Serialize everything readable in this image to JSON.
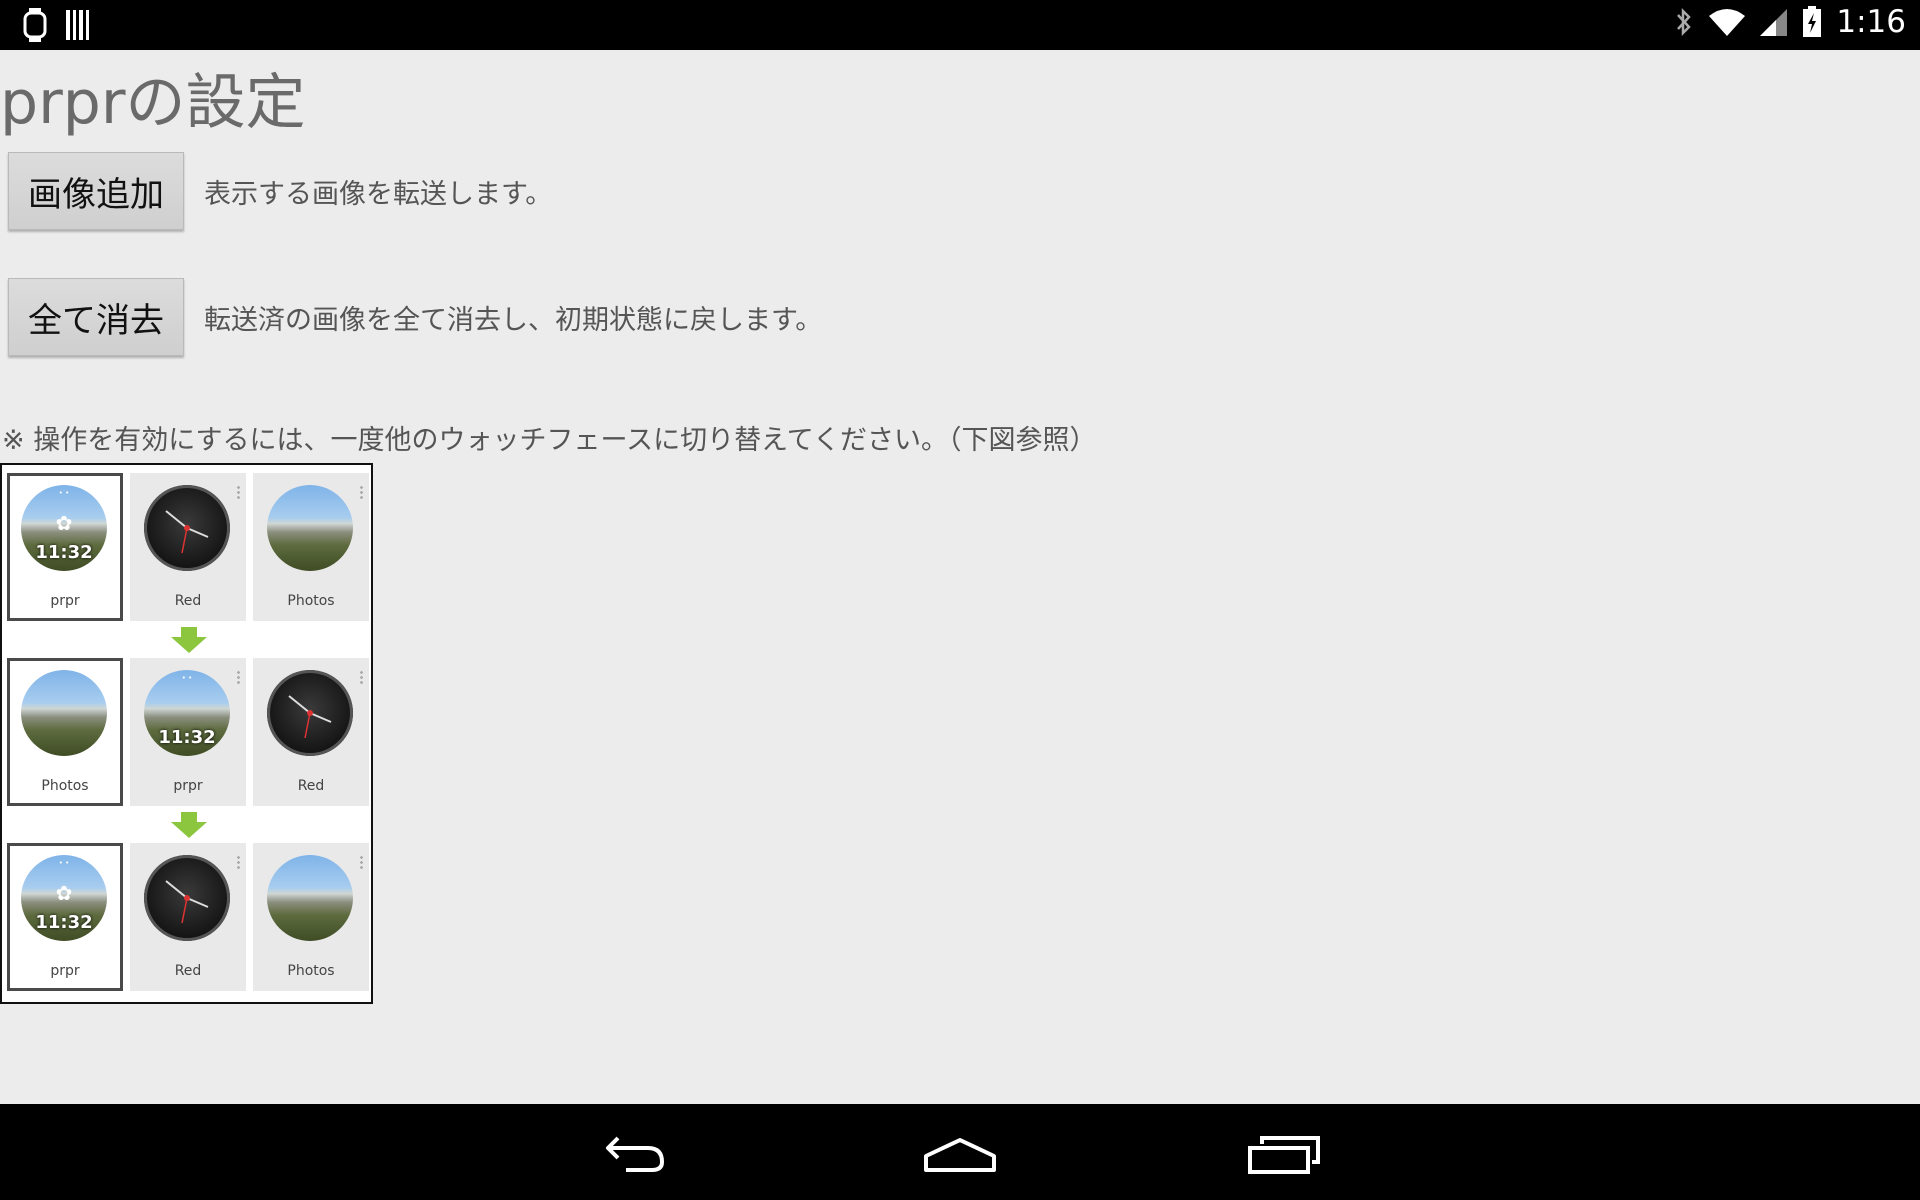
{
  "status_bar": {
    "time": "1:16",
    "left_icons": [
      "watch-icon",
      "barcode-icon"
    ],
    "right_icons": [
      "bluetooth-icon",
      "wifi-icon",
      "signal-icon",
      "battery-charging-icon"
    ]
  },
  "page": {
    "title": "prprの設定",
    "add_image": {
      "label": "画像追加",
      "description": "表示する画像を転送します。"
    },
    "clear_all": {
      "label": "全て消去",
      "description": "転送済の画像を全て消去し、初期状態に戻します。"
    },
    "note": "※ 操作を有効にするには、一度他のウォッチフェースに切り替えてください。（下図参照）"
  },
  "illustration": {
    "rows": [
      {
        "cards": [
          {
            "label": "prpr",
            "face": "photo",
            "time": "11:32",
            "gear": true,
            "selected": true
          },
          {
            "label": "Red",
            "face": "dark",
            "selected": false
          },
          {
            "label": "Photos",
            "face": "photo",
            "selected": false
          }
        ]
      },
      {
        "cards": [
          {
            "label": "Photos",
            "face": "photo",
            "selected": true
          },
          {
            "label": "prpr",
            "face": "photo",
            "time": "11:32",
            "selected": false
          },
          {
            "label": "Red",
            "face": "dark",
            "selected": false
          }
        ]
      },
      {
        "cards": [
          {
            "label": "prpr",
            "face": "photo",
            "time": "11:32",
            "gear": true,
            "selected": true
          },
          {
            "label": "Red",
            "face": "dark",
            "selected": false
          },
          {
            "label": "Photos",
            "face": "photo",
            "selected": false
          }
        ]
      }
    ],
    "arrow_color": "#8cc63f"
  },
  "nav_bar": {
    "buttons": [
      "back-icon",
      "home-icon",
      "recent-apps-icon"
    ]
  }
}
